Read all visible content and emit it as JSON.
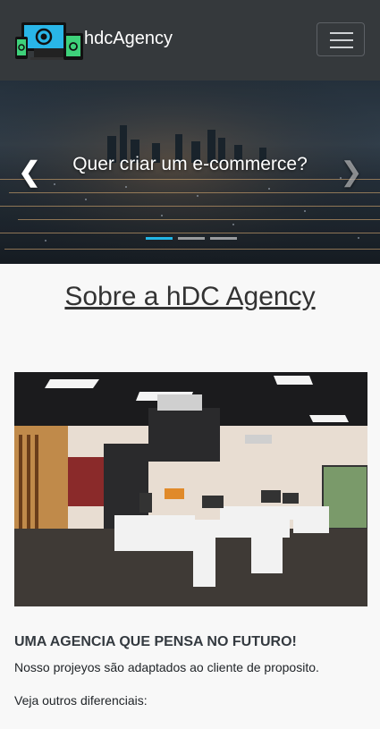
{
  "navbar": {
    "brand": "hdcAgency",
    "menu_icon": "hamburger-menu-icon",
    "background": "#35393c"
  },
  "carousel": {
    "caption": "Quer criar um e-commerce?",
    "prev_icon": "chevron-left-icon",
    "next_icon": "chevron-right-icon",
    "slide_count": 3,
    "active_slide": 1,
    "accent": "#22b6e6"
  },
  "about": {
    "title": "Sobre a hDC Agency",
    "headline": "UMA AGENCIA QUE PENSA NO FUTURO!",
    "text1": "Nosso projeyos são adaptados ao cliente de proposito.",
    "text2": "Veja outros diferenciais:"
  }
}
